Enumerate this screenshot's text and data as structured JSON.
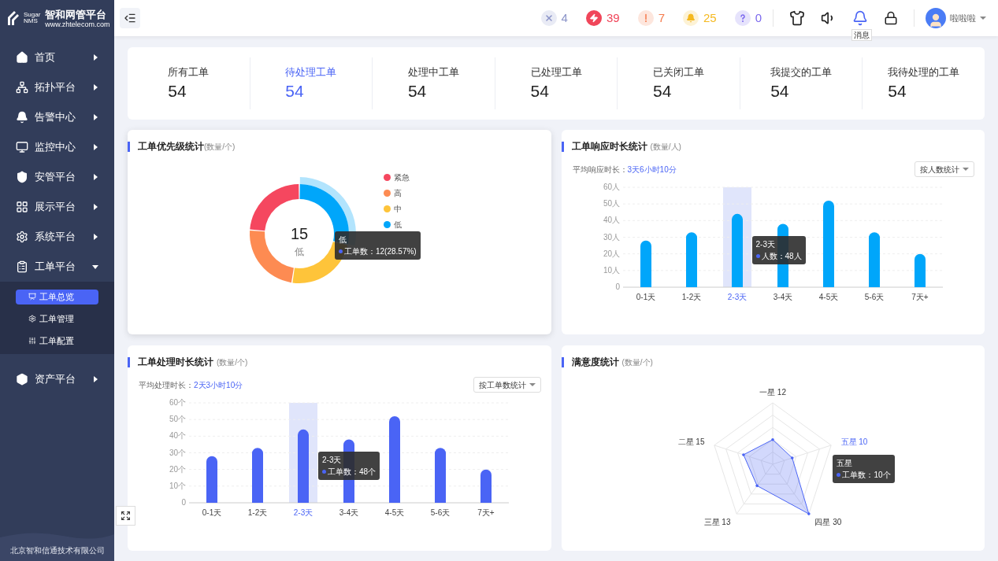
{
  "brand": {
    "logo_lines": [
      "Sugar",
      "NMS"
    ],
    "name": "智和网管平台",
    "url": "www.zhtelecom.com"
  },
  "sidebar": {
    "items": [
      {
        "label": "首页",
        "expanded": false
      },
      {
        "label": "拓扑平台",
        "expanded": false
      },
      {
        "label": "告警中心",
        "expanded": false
      },
      {
        "label": "监控中心",
        "expanded": false
      },
      {
        "label": "安管平台",
        "expanded": false
      },
      {
        "label": "展示平台",
        "expanded": false
      },
      {
        "label": "系统平台",
        "expanded": false
      },
      {
        "label": "工单平台",
        "expanded": true,
        "children": [
          {
            "label": "工单总览",
            "selected": true
          },
          {
            "label": "工单管理",
            "selected": false
          },
          {
            "label": "工单配置",
            "selected": false
          }
        ]
      },
      {
        "label": "资产平台",
        "expanded": false
      }
    ],
    "footer": "北京智和信通技术有限公司"
  },
  "topbar": {
    "alerts": [
      {
        "count": "4",
        "color": "#8a93c8",
        "filled": false
      },
      {
        "count": "39",
        "color": "#f0465a",
        "filled": true
      },
      {
        "count": "7",
        "color": "#f5794a",
        "filled": false
      },
      {
        "count": "25",
        "color": "#f5b920",
        "filled": false
      },
      {
        "count": "0",
        "color": "#7b68ee",
        "filled": false
      }
    ],
    "tooltip": "消息",
    "user": "啦啦啦"
  },
  "stats": [
    {
      "label": "所有工单",
      "value": "54",
      "selected": false
    },
    {
      "label": "待处理工单",
      "value": "54",
      "selected": true
    },
    {
      "label": "处理中工单",
      "value": "54",
      "selected": false
    },
    {
      "label": "已处理工单",
      "value": "54",
      "selected": false
    },
    {
      "label": "已关闭工单",
      "value": "54",
      "selected": false
    },
    {
      "label": "我提交的工单",
      "value": "54",
      "selected": false
    },
    {
      "label": "我待处理的工单",
      "value": "54",
      "selected": false
    }
  ],
  "priority": {
    "title": "工单优先级统计",
    "unit": "(数量/个)",
    "center_value": "15",
    "center_label": "低",
    "chart_data": {
      "type": "donut",
      "categories": [
        "紧急",
        "高",
        "中",
        "低"
      ],
      "legend": "right",
      "series": [
        {
          "name": "工单数",
          "values": [
            23.81,
            23.81,
            23.81,
            28.57
          ]
        }
      ],
      "colors": [
        "#f5475f",
        "#fd8b52",
        "#fec43a",
        "#00a6fa"
      ]
    },
    "tooltip": {
      "title": "低",
      "value": "：12(28.57%)"
    }
  },
  "response": {
    "title": "工单响应时长统计",
    "unit": "(数量/人)",
    "avg_label": "平均响应时长：",
    "avg_value": "3天6小时10分",
    "select": "按人数统计",
    "chart_data": {
      "type": "bar",
      "categories": [
        "0-1天",
        "1-2天",
        "2-3天",
        "3-4天",
        "4-5天",
        "5-6天",
        "7天+"
      ],
      "grid": true,
      "series": [
        {
          "name": "人数",
          "color": "#00a6fa",
          "values": [
            28,
            33,
            44,
            38,
            52,
            33,
            20
          ]
        }
      ],
      "ylim": [
        0,
        60
      ],
      "yticks": [
        {
          "value": 0,
          "label": "0"
        },
        {
          "value": 10,
          "label": "10人"
        },
        {
          "value": 20,
          "label": "20人"
        },
        {
          "value": 30,
          "label": "30人"
        },
        {
          "value": 40,
          "label": "40人"
        },
        {
          "value": 50,
          "label": "50人"
        },
        {
          "value": 60,
          "label": "60人"
        }
      ]
    },
    "tooltip": {
      "title": "2-3天",
      "value": "：48人"
    }
  },
  "processing": {
    "title": "工单处理时长统计",
    "unit": "(数量/个)",
    "avg_label": "平均处理时长：",
    "avg_value": "2天3小时10分",
    "select": "按工单数统计",
    "chart_data": {
      "type": "bar",
      "categories": [
        "0-1天",
        "1-2天",
        "2-3天",
        "3-4天",
        "4-5天",
        "5-6天",
        "7天+"
      ],
      "grid": true,
      "series": [
        {
          "name": "工单数",
          "color": "#4a64f5",
          "values": [
            28,
            33,
            44,
            38,
            52,
            33,
            20
          ]
        }
      ],
      "ylim": [
        0,
        60
      ],
      "yticks": [
        {
          "value": 0,
          "label": "0"
        },
        {
          "value": 10,
          "label": "10个"
        },
        {
          "value": 20,
          "label": "20个"
        },
        {
          "value": 30,
          "label": "30个"
        },
        {
          "value": 40,
          "label": "40个"
        },
        {
          "value": 50,
          "label": "50个"
        },
        {
          "value": 60,
          "label": "60个"
        }
      ]
    },
    "tooltip": {
      "title": "2-3天",
      "value": "：48个"
    }
  },
  "satisfaction": {
    "title": "满意度统计",
    "unit": "(数量/个)",
    "series_name": "工单数",
    "axes": [
      {
        "label": "一星",
        "value": "12"
      },
      {
        "label": "二星",
        "value": "15"
      },
      {
        "label": "三星",
        "value": "13"
      },
      {
        "label": "四星",
        "value": "30"
      },
      {
        "label": "五星",
        "value": "10"
      }
    ],
    "tooltip": {
      "title": "五星",
      "value": "：10个"
    }
  }
}
